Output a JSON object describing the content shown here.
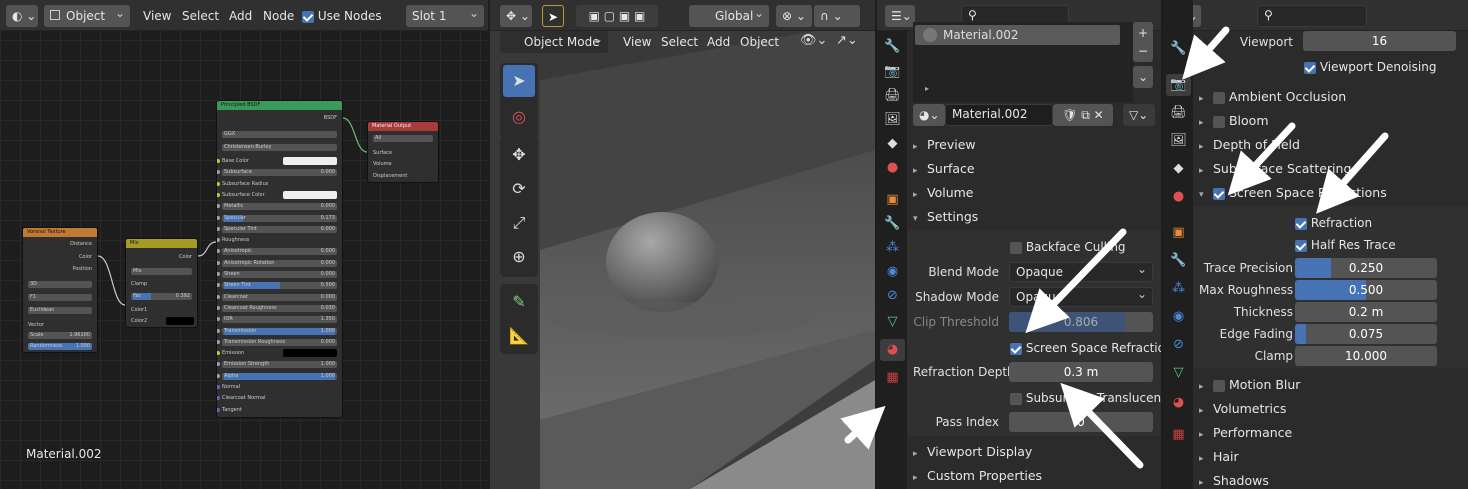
{
  "node_editor": {
    "header": {
      "object_mode": "Object",
      "menus": [
        "View",
        "Select",
        "Add",
        "Node"
      ],
      "use_nodes": "Use Nodes",
      "slot": "Slot 1"
    },
    "material_label": "Material.002",
    "voronoi": {
      "title": "Voronoi Texture",
      "outputs": [
        "Distance",
        "Color",
        "Position"
      ],
      "dim": "3D",
      "feature": "F1",
      "metric": "Euclidean",
      "vector": "Vector",
      "scale_label": "Scale",
      "scale": "1.96100",
      "rand_label": "Randomness",
      "rand": "1.000"
    },
    "mix": {
      "title": "Mix",
      "out": "Color",
      "mode": "Mix",
      "clamp": "Clamp",
      "fac_label": "Fac",
      "fac": "0.392",
      "c1": "Color1",
      "c2": "Color2"
    },
    "bsdf": {
      "title": "Principled BSDF",
      "out": "BSDF",
      "dist": "GGX",
      "sss": "Christensen-Burley",
      "rows": [
        [
          "Base Color",
          ""
        ],
        [
          "Subsurface",
          "0.000"
        ],
        [
          "Subsurface Radius",
          ""
        ],
        [
          "Subsurface Color",
          ""
        ],
        [
          "Metallic",
          "0.000"
        ],
        [
          "Specular",
          "0.173"
        ],
        [
          "Specular Tint",
          "0.000"
        ],
        [
          "Roughness",
          ""
        ],
        [
          "Anisotropic",
          "0.000"
        ],
        [
          "Anisotropic Rotation",
          "0.000"
        ],
        [
          "Sheen",
          "0.000"
        ],
        [
          "Sheen Tint",
          "0.500"
        ],
        [
          "Clearcoat",
          "0.000"
        ],
        [
          "Clearcoat Roughness",
          "0.030"
        ],
        [
          "IOR",
          "1.350"
        ],
        [
          "Transmission",
          "1.000"
        ],
        [
          "Transmission Roughness",
          "0.000"
        ],
        [
          "Emission",
          ""
        ],
        [
          "Emission Strength",
          "1.000"
        ],
        [
          "Alpha",
          "1.000"
        ],
        [
          "Normal",
          ""
        ],
        [
          "Clearcoat Normal",
          ""
        ],
        [
          "Tangent",
          ""
        ]
      ]
    },
    "output": {
      "title": "Material Output",
      "target": "All",
      "inputs": [
        "Surface",
        "Volume",
        "Displacement"
      ]
    }
  },
  "viewport": {
    "header": {
      "transform": "Global",
      "mode": "Object Mode",
      "menus": [
        "View",
        "Select",
        "Add",
        "Object"
      ]
    }
  },
  "material_panel": {
    "slot_name": "Material.002",
    "datablock": "Material.002",
    "sections": [
      "Preview",
      "Surface",
      "Volume",
      "Settings"
    ],
    "backface": "Backface Culling",
    "blend_label": "Blend Mode",
    "blend": "Opaque",
    "shadow_label": "Shadow Mode",
    "shadow": "Opaque",
    "clip_label": "Clip Threshold",
    "clip": "0.806",
    "ssr": "Screen Space Refraction",
    "depth_label": "Refraction Depth",
    "depth": "0.3 m",
    "subsurface": "Subsurface Translucency",
    "pass_label": "Pass Index",
    "pass": "0",
    "footer": [
      "Viewport Display",
      "Custom Properties"
    ]
  },
  "render_panel": {
    "viewport_label": "Viewport",
    "viewport": "16",
    "denoise": "Viewport Denoising",
    "sections": [
      "Ambient Occlusion",
      "Bloom",
      "Depth of Field",
      "Subsurface Scattering",
      "Screen Space Reflections"
    ],
    "refraction": "Refraction",
    "halfres": "Half Res Trace",
    "rows": [
      [
        "Trace Precision",
        "0.250",
        0.25
      ],
      [
        "Max Roughness",
        "0.500",
        0.5
      ],
      [
        "Thickness",
        "0.2 m",
        0
      ],
      [
        "Edge Fading",
        "0.075",
        0.075
      ],
      [
        "Clamp",
        "10.000",
        0
      ]
    ],
    "lower": [
      "Motion Blur",
      "Volumetrics",
      "Performance",
      "Hair",
      "Shadows"
    ]
  }
}
